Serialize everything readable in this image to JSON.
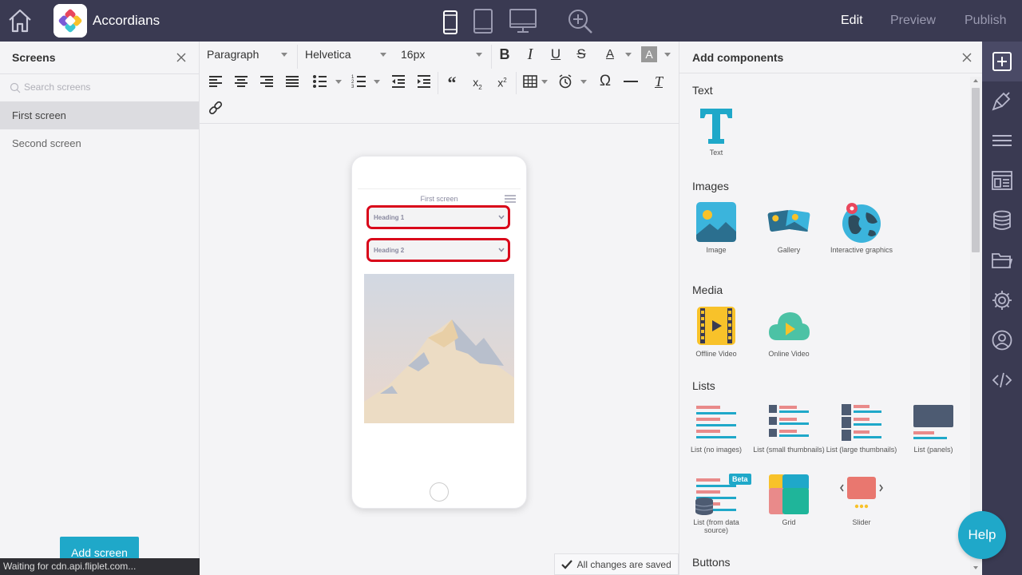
{
  "app": {
    "title": "Accordians",
    "modes": {
      "edit": "Edit",
      "preview": "Preview",
      "publish": "Publish"
    }
  },
  "screens_panel": {
    "title": "Screens",
    "search_placeholder": "Search screens",
    "items": [
      {
        "label": "First screen",
        "selected": true
      },
      {
        "label": "Second screen",
        "selected": false
      }
    ],
    "add_button": "Add screen"
  },
  "toolbar": {
    "block_format": "Paragraph",
    "font_family": "Helvetica",
    "font_size": "16px"
  },
  "phone_preview": {
    "screen_title": "First screen",
    "accordions": [
      "Heading 1",
      "Heading 2"
    ],
    "highlight_color": "#d9061a"
  },
  "components_panel": {
    "title": "Add components",
    "categories": {
      "text": "Text",
      "images": "Images",
      "media": "Media",
      "lists": "Lists",
      "buttons": "Buttons"
    },
    "components": {
      "text": "Text",
      "image": "Image",
      "gallery": "Gallery",
      "interactive_graphics": "Interactive graphics",
      "offline_video": "Offline Video",
      "online_video": "Online Video",
      "list_no_images": "List (no images)",
      "list_small_thumbnails": "List (small thumbnails)",
      "list_large_thumbnails": "List (large thumbnails)",
      "list_panels": "List (panels)",
      "list_data_source": "List (from data source)",
      "grid": "Grid",
      "slider": "Slider"
    },
    "beta_badge": "Beta"
  },
  "save_status": "All changes are saved",
  "status_bar": "Waiting for cdn.api.fliplet.com...",
  "help_button": "Help",
  "colors": {
    "topbar": "#3a3a52",
    "accent": "#1fa8c9",
    "highlight": "#d9061a"
  }
}
